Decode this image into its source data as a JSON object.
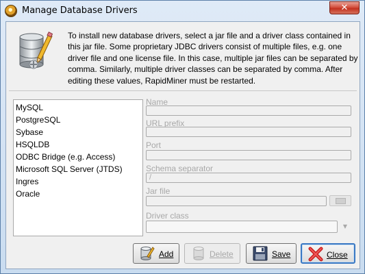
{
  "window": {
    "title": "Manage Database Drivers",
    "close_glyph": "✕"
  },
  "info_text": "To install new database drivers, select a jar file and a driver class contained in this jar file. Some proprietary JDBC drivers consist of multiple files, e.g. one driver file and one license file. In this case, multiple jar files can be separated by comma. Similarly, multiple driver classes can be separated by comma. After editing these values, RapidMiner must be restarted.",
  "drivers": [
    "MySQL",
    "PostgreSQL",
    "Sybase",
    "HSQLDB",
    "ODBC Bridge (e.g. Access)",
    "Microsoft SQL Server (JTDS)",
    "Ingres",
    "Oracle"
  ],
  "form": {
    "name_label": "Name",
    "name_value": "",
    "url_prefix_label": "URL prefix",
    "url_prefix_value": "",
    "port_label": "Port",
    "port_value": "",
    "schema_separator_label": "Schema separator",
    "schema_separator_value": "/",
    "jar_file_label": "Jar file",
    "jar_file_value": "",
    "driver_class_label": "Driver class",
    "driver_class_value": ""
  },
  "buttons": {
    "add": "Add",
    "delete": "Delete",
    "save": "Save",
    "close": "Close"
  },
  "icons": {
    "app": "rapidminer-logo-icon",
    "header": "database-edit-icon",
    "add": "database-add-icon",
    "delete": "database-delete-icon",
    "save": "floppy-disk-icon",
    "close": "red-x-icon",
    "browse": "folder-icon"
  },
  "colors": {
    "disabled_text": "#a8a8a8",
    "close_red": "#c33120",
    "focus_blue": "#3a78c3"
  }
}
